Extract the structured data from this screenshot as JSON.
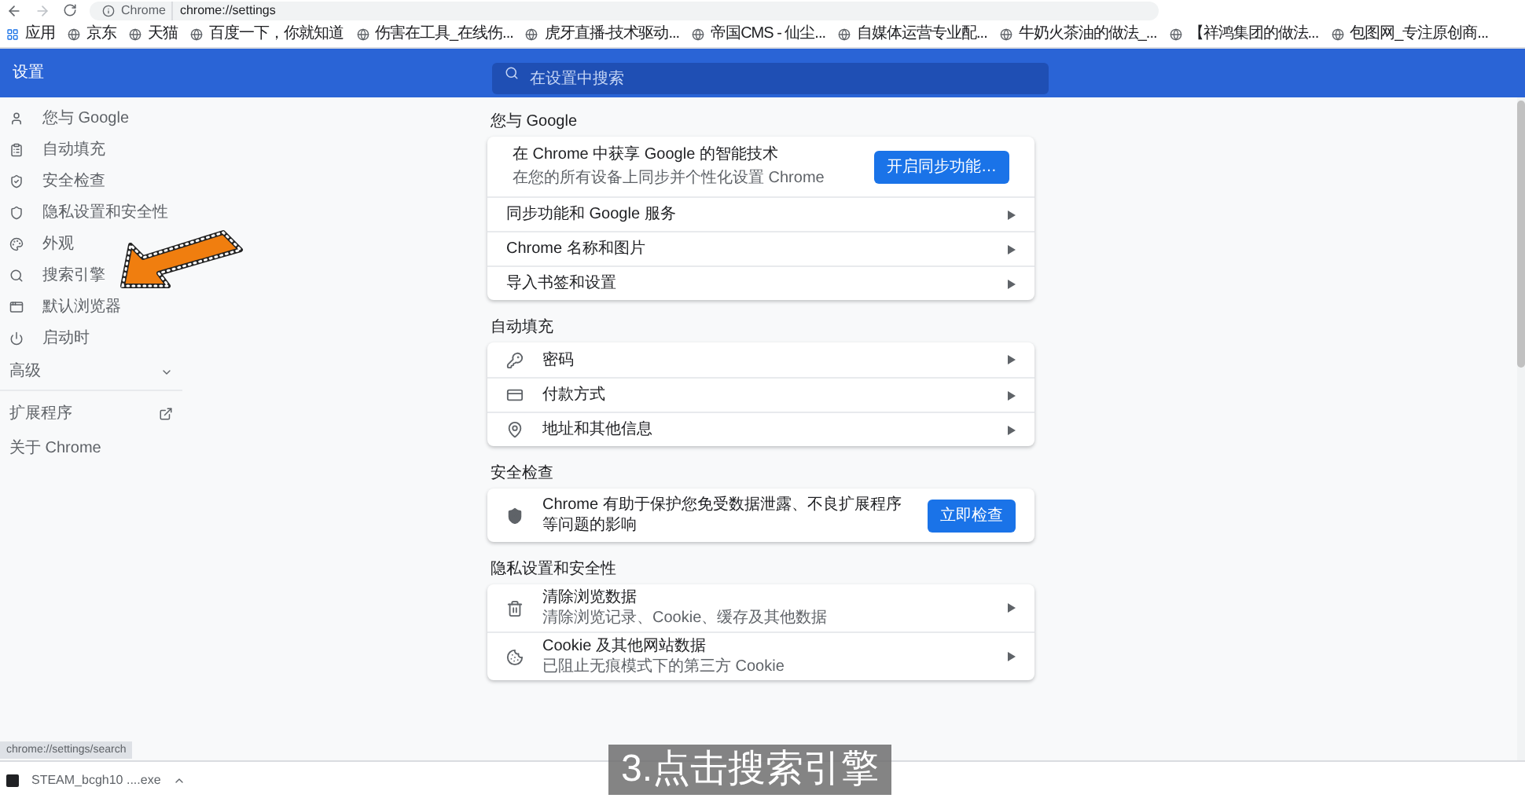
{
  "toolbar": {
    "site_label": "Chrome",
    "url": "chrome://settings"
  },
  "bookmarks": [
    "应用",
    "京东",
    "天猫",
    "百度一下，你就知道",
    "伤害在工具_在线伤...",
    "虎牙直播-技术驱动...",
    "帝国CMS - 仙尘...",
    "自媒体运营专业配...",
    "牛奶火茶油的做法_...",
    "【祥鸿集团的做法...",
    "包图网_专注原创商..."
  ],
  "header": {
    "title": "设置",
    "search_placeholder": "在设置中搜索"
  },
  "sidebar": {
    "items": [
      "您与 Google",
      "自动填充",
      "安全检查",
      "隐私设置和安全性",
      "外观",
      "搜索引擎",
      "默认浏览器",
      "启动时"
    ],
    "advanced": {
      "label": "高级",
      "expanded": false
    },
    "extensions": "扩展程序",
    "about": "关于 Chrome"
  },
  "sections": [
    {
      "title": "您与 Google",
      "rows": [
        {
          "kind": "promo",
          "title": "在 Chrome 中获享 Google 的智能技术",
          "subtitle": "在您的所有设备上同步并个性化设置 Chrome",
          "button": "开启同步功能…"
        },
        {
          "kind": "link",
          "title": "同步功能和 Google 服务"
        },
        {
          "kind": "link",
          "title": "Chrome 名称和图片"
        },
        {
          "kind": "link",
          "title": "导入书签和设置"
        }
      ]
    },
    {
      "title": "自动填充",
      "rows": [
        {
          "kind": "link",
          "title": "密码"
        },
        {
          "kind": "link",
          "title": "付款方式"
        },
        {
          "kind": "link",
          "title": "地址和其他信息"
        }
      ]
    },
    {
      "title": "安全检查",
      "rows": [
        {
          "kind": "action",
          "title": "Chrome 有助于保护您免受数据泄露、不良扩展程序等问题的影响",
          "button": "立即检查"
        }
      ]
    },
    {
      "title": "隐私设置和安全性",
      "rows": [
        {
          "kind": "link",
          "title": "清除浏览数据",
          "subtitle": "清除浏览记录、Cookie、缓存及其他数据"
        },
        {
          "kind": "link",
          "title": "Cookie 及其他网站数据",
          "subtitle": "已阻止无痕模式下的第三方 Cookie"
        }
      ]
    }
  ],
  "status_url": "chrome://settings/search",
  "download": {
    "filename": "STEAM_bcgh10 ....exe"
  },
  "caption": "3.点击搜索引擎"
}
